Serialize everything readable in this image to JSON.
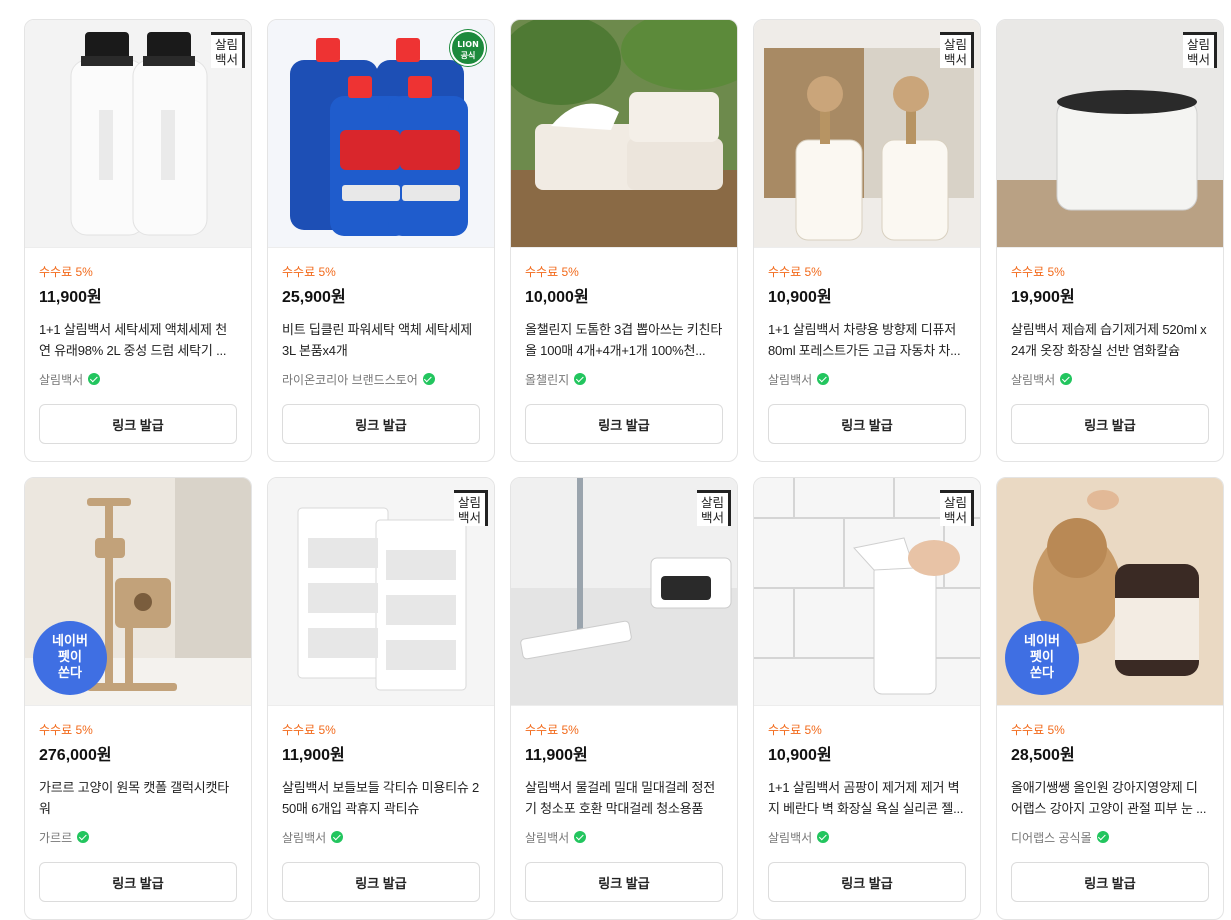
{
  "button_label": "링크 발급",
  "brand_badge_text": [
    "살림",
    "백서"
  ],
  "naver_badge_text": [
    "네이버",
    "펫이",
    "쏜다"
  ],
  "lion_badge_text": [
    "LION",
    "공식"
  ],
  "colors": {
    "commission": "#f26a1b",
    "verified": "#22c55e",
    "naver_badge": "#3f6fe3",
    "lion_badge": "#1c8a3c"
  },
  "products": [
    {
      "commission": "수수료 5%",
      "price": "11,900원",
      "title": "1+1 살림백서 세탁세제 액체세제 천연 유래98% 2L 중성 드럼 세탁기 ...",
      "seller": "살림백서",
      "badge": "brand"
    },
    {
      "commission": "수수료 5%",
      "price": "25,900원",
      "title": "비트 딥클린 파워세탁 액체 세탁세제 3L 본품x4개",
      "seller": "라이온코리아 브랜드스토어",
      "badge": "lion"
    },
    {
      "commission": "수수료 5%",
      "price": "10,000원",
      "title": "올챌린지 도톰한 3겹 뽑아쓰는 키친타올 100매 4개+4개+1개 100%천...",
      "seller": "올챌린지",
      "badge": "none"
    },
    {
      "commission": "수수료 5%",
      "price": "10,900원",
      "title": "1+1 살림백서 차량용 방향제 디퓨저 80ml 포레스트가든 고급 자동차 차...",
      "seller": "살림백서",
      "badge": "brand"
    },
    {
      "commission": "수수료 5%",
      "price": "19,900원",
      "title": "살림백서 제습제 습기제거제 520ml x 24개 옷장 화장실 선반 염화칼슘",
      "seller": "살림백서",
      "badge": "brand"
    },
    {
      "commission": "수수료 5%",
      "price": "276,000원",
      "title": "가르르 고양이 원목 캣폴 갤럭시캣타워",
      "seller": "가르르",
      "badge": "naver"
    },
    {
      "commission": "수수료 5%",
      "price": "11,900원",
      "title": "살림백서 보들보들 각티슈 미용티슈 250매 6개입 곽휴지 곽티슈",
      "seller": "살림백서",
      "badge": "brand"
    },
    {
      "commission": "수수료 5%",
      "price": "11,900원",
      "title": "살림백서 물걸레 밀대 밀대걸레 정전기 청소포 호환 막대걸레 청소용품",
      "seller": "살림백서",
      "badge": "brand"
    },
    {
      "commission": "수수료 5%",
      "price": "10,900원",
      "title": "1+1 살림백서 곰팡이 제거제 제거 벽지 베란다 벽 화장실 욕실 실리콘 젤...",
      "seller": "살림백서",
      "badge": "brand"
    },
    {
      "commission": "수수료 5%",
      "price": "28,500원",
      "title": "올애기쌩쌩 올인원 강아지영양제 디어랩스 강아지 고양이 관절 피부 눈 ...",
      "seller": "디어랩스 공식몰",
      "badge": "naver"
    }
  ]
}
